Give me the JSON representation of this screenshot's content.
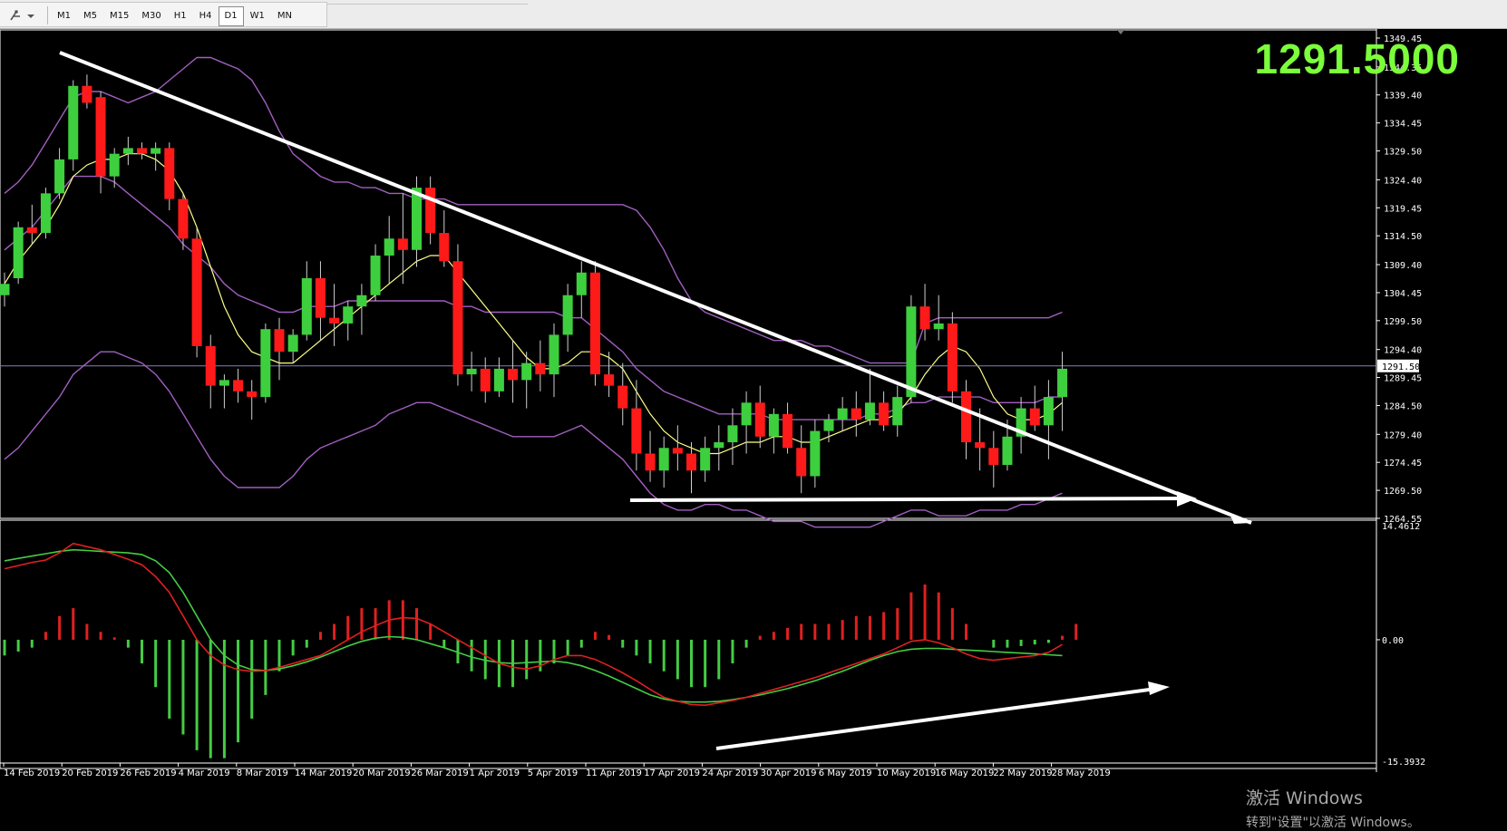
{
  "toolbar": {
    "draw_tool_icon": "line-tool-icon",
    "timeframes": [
      "M1",
      "M5",
      "M15",
      "M30",
      "H1",
      "H4",
      "D1",
      "W1",
      "MN"
    ],
    "active_timeframe": "D1"
  },
  "price_display": "1291.5000",
  "current_price_label": "1291.50",
  "colors": {
    "bull": "#3ecf3e",
    "bear": "#ff1a1a",
    "bollinger": "#a05fc0",
    "ma": "#ffff88",
    "hline": "#8a7fb3",
    "macd_signal_green": "#44cc44",
    "macd_red": "#e02020"
  },
  "watermark": {
    "line1": "激活 Windows",
    "line2": "转到\"设置\"以激活 Windows。"
  },
  "chart_data": [
    {
      "type": "candlestick",
      "price_axis_ticks": [
        "1349.45",
        "1344.35",
        "1339.40",
        "1334.45",
        "1329.50",
        "1324.40",
        "1319.45",
        "1314.50",
        "1309.40",
        "1304.45",
        "1299.50",
        "1294.40",
        "1289.45",
        "1284.50",
        "1279.40",
        "1274.45",
        "1269.50",
        "1264.55"
      ],
      "ylim": [
        1264.55,
        1349.45
      ],
      "date_labels": [
        "14 Feb 2019",
        "20 Feb 2019",
        "26 Feb 2019",
        "4 Mar 2019",
        "8 Mar 2019",
        "14 Mar 2019",
        "20 Mar 2019",
        "26 Mar 2019",
        "1 Apr 2019",
        "5 Apr 2019",
        "11 Apr 2019",
        "17 Apr 2019",
        "24 Apr 2019",
        "30 Apr 2019",
        "6 May 2019",
        "10 May 2019",
        "16 May 2019",
        "22 May 2019",
        "28 May 2019"
      ],
      "ohlc": [
        [
          1304,
          1308,
          1302,
          1306
        ],
        [
          1307,
          1317,
          1306,
          1316
        ],
        [
          1316,
          1320,
          1313,
          1315
        ],
        [
          1315,
          1323,
          1314,
          1322
        ],
        [
          1322,
          1330,
          1321,
          1328
        ],
        [
          1328,
          1342,
          1326,
          1341
        ],
        [
          1341,
          1343,
          1337,
          1338
        ],
        [
          1339,
          1340,
          1322,
          1325
        ],
        [
          1325,
          1330,
          1323,
          1329
        ],
        [
          1329,
          1332,
          1327,
          1330
        ],
        [
          1330,
          1331,
          1328,
          1329
        ],
        [
          1329,
          1331,
          1326,
          1330
        ],
        [
          1330,
          1331,
          1319,
          1321
        ],
        [
          1321,
          1322,
          1312,
          1314
        ],
        [
          1314,
          1316,
          1293,
          1295
        ],
        [
          1295,
          1297,
          1284,
          1288
        ],
        [
          1288,
          1290,
          1284,
          1289
        ],
        [
          1289,
          1291,
          1285,
          1287
        ],
        [
          1287,
          1289,
          1282,
          1286
        ],
        [
          1286,
          1299,
          1285,
          1298
        ],
        [
          1298,
          1300,
          1289,
          1294
        ],
        [
          1294,
          1298,
          1292,
          1297
        ],
        [
          1297,
          1310,
          1296,
          1307
        ],
        [
          1307,
          1310,
          1296,
          1300
        ],
        [
          1300,
          1306,
          1295,
          1299
        ],
        [
          1299,
          1303,
          1296,
          1302
        ],
        [
          1302,
          1306,
          1297,
          1304
        ],
        [
          1304,
          1313,
          1303,
          1311
        ],
        [
          1311,
          1318,
          1306,
          1314
        ],
        [
          1314,
          1322,
          1306,
          1312
        ],
        [
          1312,
          1325,
          1309,
          1323
        ],
        [
          1323,
          1325,
          1313,
          1315
        ],
        [
          1315,
          1319,
          1309,
          1310
        ],
        [
          1310,
          1313,
          1288,
          1290
        ],
        [
          1290,
          1294,
          1287,
          1291
        ],
        [
          1291,
          1293,
          1285,
          1287
        ],
        [
          1287,
          1293,
          1286,
          1291
        ],
        [
          1291,
          1296,
          1285,
          1289
        ],
        [
          1289,
          1294,
          1284,
          1292
        ],
        [
          1292,
          1296,
          1287,
          1290
        ],
        [
          1290,
          1299,
          1286,
          1297
        ],
        [
          1297,
          1306,
          1294,
          1304
        ],
        [
          1304,
          1310,
          1300,
          1308
        ],
        [
          1308,
          1310,
          1288,
          1290
        ],
        [
          1290,
          1294,
          1286,
          1288
        ],
        [
          1288,
          1292,
          1281,
          1284
        ],
        [
          1284,
          1289,
          1273,
          1276
        ],
        [
          1276,
          1280,
          1271,
          1273
        ],
        [
          1273,
          1279,
          1270,
          1277
        ],
        [
          1277,
          1281,
          1273,
          1276
        ],
        [
          1276,
          1278,
          1269,
          1273
        ],
        [
          1273,
          1279,
          1271,
          1277
        ],
        [
          1277,
          1281,
          1273,
          1278
        ],
        [
          1278,
          1284,
          1274,
          1281
        ],
        [
          1281,
          1287,
          1276,
          1285
        ],
        [
          1285,
          1288,
          1277,
          1279
        ],
        [
          1279,
          1284,
          1276,
          1283
        ],
        [
          1283,
          1285,
          1276,
          1277
        ],
        [
          1277,
          1281,
          1269,
          1272
        ],
        [
          1272,
          1282,
          1270,
          1280
        ],
        [
          1280,
          1283,
          1278,
          1282
        ],
        [
          1282,
          1286,
          1280,
          1284
        ],
        [
          1284,
          1287,
          1279,
          1282
        ],
        [
          1282,
          1291,
          1281,
          1285
        ],
        [
          1285,
          1287,
          1280,
          1281
        ],
        [
          1281,
          1288,
          1279,
          1286
        ],
        [
          1286,
          1304,
          1285,
          1302
        ],
        [
          1302,
          1306,
          1296,
          1298
        ],
        [
          1298,
          1304,
          1296,
          1299
        ],
        [
          1299,
          1301,
          1285,
          1287
        ],
        [
          1287,
          1289,
          1275,
          1278
        ],
        [
          1278,
          1284,
          1273,
          1277
        ],
        [
          1277,
          1280,
          1270,
          1274
        ],
        [
          1274,
          1282,
          1273,
          1279
        ],
        [
          1279,
          1286,
          1276,
          1284
        ],
        [
          1284,
          1288,
          1280,
          1281
        ],
        [
          1281,
          1289,
          1275,
          1286
        ],
        [
          1286,
          1294,
          1280,
          1291
        ]
      ],
      "bollinger_upper": [
        1322,
        1324,
        1327,
        1331,
        1335,
        1339,
        1340,
        1340,
        1339,
        1338,
        1339,
        1340,
        1342,
        1344,
        1346,
        1346,
        1345,
        1344,
        1342,
        1338,
        1333,
        1329,
        1327,
        1325,
        1324,
        1324,
        1323,
        1323,
        1322,
        1322,
        1321,
        1321,
        1321,
        1320,
        1320,
        1320,
        1320,
        1320,
        1320,
        1320,
        1320,
        1320,
        1320,
        1320,
        1320,
        1320,
        1319,
        1316,
        1312,
        1307,
        1303,
        1301,
        1300,
        1299,
        1298,
        1297,
        1296,
        1296,
        1296,
        1295,
        1295,
        1294,
        1293,
        1292,
        1292,
        1292,
        1292,
        1299,
        1300,
        1300,
        1300,
        1300,
        1300,
        1300,
        1300,
        1300,
        1300,
        1301
      ],
      "bollinger_mid": [
        1312,
        1314,
        1316,
        1319,
        1322,
        1325,
        1325,
        1325,
        1324,
        1322,
        1320,
        1318,
        1316,
        1313,
        1311,
        1309,
        1306,
        1304,
        1303,
        1302,
        1301,
        1301,
        1302,
        1302,
        1302,
        1303,
        1303,
        1303,
        1303,
        1303,
        1303,
        1303,
        1303,
        1302,
        1302,
        1301,
        1301,
        1301,
        1301,
        1301,
        1301,
        1300,
        1300,
        1298,
        1296,
        1294,
        1291,
        1289,
        1287,
        1286,
        1285,
        1284,
        1283,
        1283,
        1283,
        1283,
        1282,
        1282,
        1282,
        1282,
        1282,
        1282,
        1282,
        1283,
        1283,
        1284,
        1285,
        1285,
        1286,
        1286,
        1286,
        1286,
        1285,
        1285,
        1285,
        1285,
        1286,
        1286
      ],
      "bollinger_lower": [
        1275,
        1277,
        1280,
        1283,
        1286,
        1290,
        1292,
        1294,
        1294,
        1293,
        1292,
        1290,
        1287,
        1283,
        1279,
        1275,
        1272,
        1270,
        1270,
        1270,
        1270,
        1272,
        1275,
        1277,
        1278,
        1279,
        1280,
        1281,
        1283,
        1284,
        1285,
        1285,
        1284,
        1283,
        1282,
        1281,
        1280,
        1279,
        1279,
        1279,
        1279,
        1280,
        1281,
        1279,
        1277,
        1275,
        1272,
        1269,
        1267,
        1266,
        1266,
        1267,
        1267,
        1266,
        1266,
        1265,
        1264,
        1264,
        1264,
        1263,
        1263,
        1263,
        1263,
        1263,
        1264,
        1265,
        1266,
        1266,
        1265,
        1265,
        1265,
        1266,
        1266,
        1266,
        1267,
        1267,
        1268,
        1269
      ],
      "ma": [
        1306,
        1310,
        1313,
        1316,
        1320,
        1325,
        1327,
        1328,
        1328,
        1329,
        1329,
        1328,
        1326,
        1322,
        1316,
        1309,
        1302,
        1297,
        1294,
        1293,
        1292,
        1292,
        1294,
        1296,
        1298,
        1300,
        1302,
        1304,
        1306,
        1308,
        1310,
        1311,
        1311,
        1308,
        1305,
        1302,
        1299,
        1296,
        1293,
        1291,
        1291,
        1292,
        1294,
        1294,
        1293,
        1291,
        1287,
        1283,
        1280,
        1278,
        1277,
        1276,
        1276,
        1277,
        1278,
        1278,
        1279,
        1279,
        1278,
        1278,
        1279,
        1280,
        1281,
        1282,
        1282,
        1283,
        1286,
        1290,
        1293,
        1295,
        1294,
        1291,
        1286,
        1283,
        1282,
        1282,
        1283,
        1285
      ]
    },
    {
      "type": "macd",
      "ylim": [
        -15.3932,
        14.4612
      ],
      "axis_labels": [
        "14.4612",
        "0.00",
        "-15.3932"
      ],
      "histogram": [
        -2,
        -1.5,
        -1,
        1,
        3,
        4,
        2,
        1,
        0.3,
        -1,
        -3,
        -6,
        -10,
        -12,
        -14,
        -15,
        -15,
        -13,
        -10,
        -7,
        -4,
        -2,
        -1,
        1,
        2,
        3,
        4,
        4,
        5,
        5,
        4,
        2,
        -1,
        -3,
        -4,
        -5,
        -6,
        -6,
        -5,
        -4,
        -3,
        -2,
        -1,
        1,
        0.6,
        -1,
        -2,
        -3,
        -4,
        -5,
        -6,
        -6,
        -5,
        -3,
        -1,
        0.5,
        1,
        1.5,
        2,
        2,
        2,
        2.5,
        3,
        3,
        3.5,
        4,
        6,
        7,
        6,
        4,
        2,
        0,
        -1,
        -1,
        -0.8,
        -0.6,
        -0.4,
        0.5,
        2
      ],
      "macd_line": [
        9,
        9.4,
        9.8,
        10.1,
        11,
        12.2,
        11.8,
        11.4,
        10.8,
        10.2,
        9.5,
        8,
        6,
        3,
        0,
        -2,
        -3.2,
        -3.8,
        -4,
        -3.9,
        -3.5,
        -3,
        -2.5,
        -2,
        -1,
        0,
        1,
        1.8,
        2.5,
        2.8,
        2.7,
        2,
        1,
        0,
        -1,
        -2,
        -3,
        -3.5,
        -3.7,
        -3.3,
        -2.5,
        -2,
        -2,
        -2.5,
        -3.3,
        -4.2,
        -5.2,
        -6.3,
        -7.3,
        -7.8,
        -8.2,
        -8.3,
        -8,
        -7.7,
        -7.3,
        -6.8,
        -6.3,
        -5.8,
        -5.3,
        -4.8,
        -4.2,
        -3.6,
        -3,
        -2.4,
        -1.8,
        -1,
        -0.2,
        0,
        -0.4,
        -1,
        -1.8,
        -2.4,
        -2.6,
        -2.4,
        -2.2,
        -2,
        -1.6,
        -0.6
      ],
      "signal_line": [
        10,
        10.3,
        10.6,
        10.9,
        11.2,
        11.4,
        11.3,
        11.2,
        11.1,
        11,
        10.8,
        10,
        8.5,
        6,
        3,
        0,
        -2,
        -3.2,
        -3.8,
        -3.9,
        -3.7,
        -3.3,
        -2.8,
        -2.2,
        -1.5,
        -0.8,
        -0.2,
        0.2,
        0.4,
        0.3,
        0,
        -0.5,
        -1,
        -1.6,
        -2.2,
        -2.6,
        -2.9,
        -3,
        -2.9,
        -2.8,
        -2.7,
        -2.9,
        -3.3,
        -3.9,
        -4.6,
        -5.4,
        -6.2,
        -7,
        -7.5,
        -7.8,
        -7.9,
        -7.9,
        -7.8,
        -7.6,
        -7.3,
        -7,
        -6.6,
        -6.2,
        -5.7,
        -5.2,
        -4.6,
        -4,
        -3.3,
        -2.6,
        -2,
        -1.5,
        -1.2,
        -1.1,
        -1.1,
        -1.2,
        -1.3,
        -1.4,
        -1.5,
        -1.6,
        -1.7,
        -1.8,
        -1.9,
        -2
      ]
    }
  ]
}
